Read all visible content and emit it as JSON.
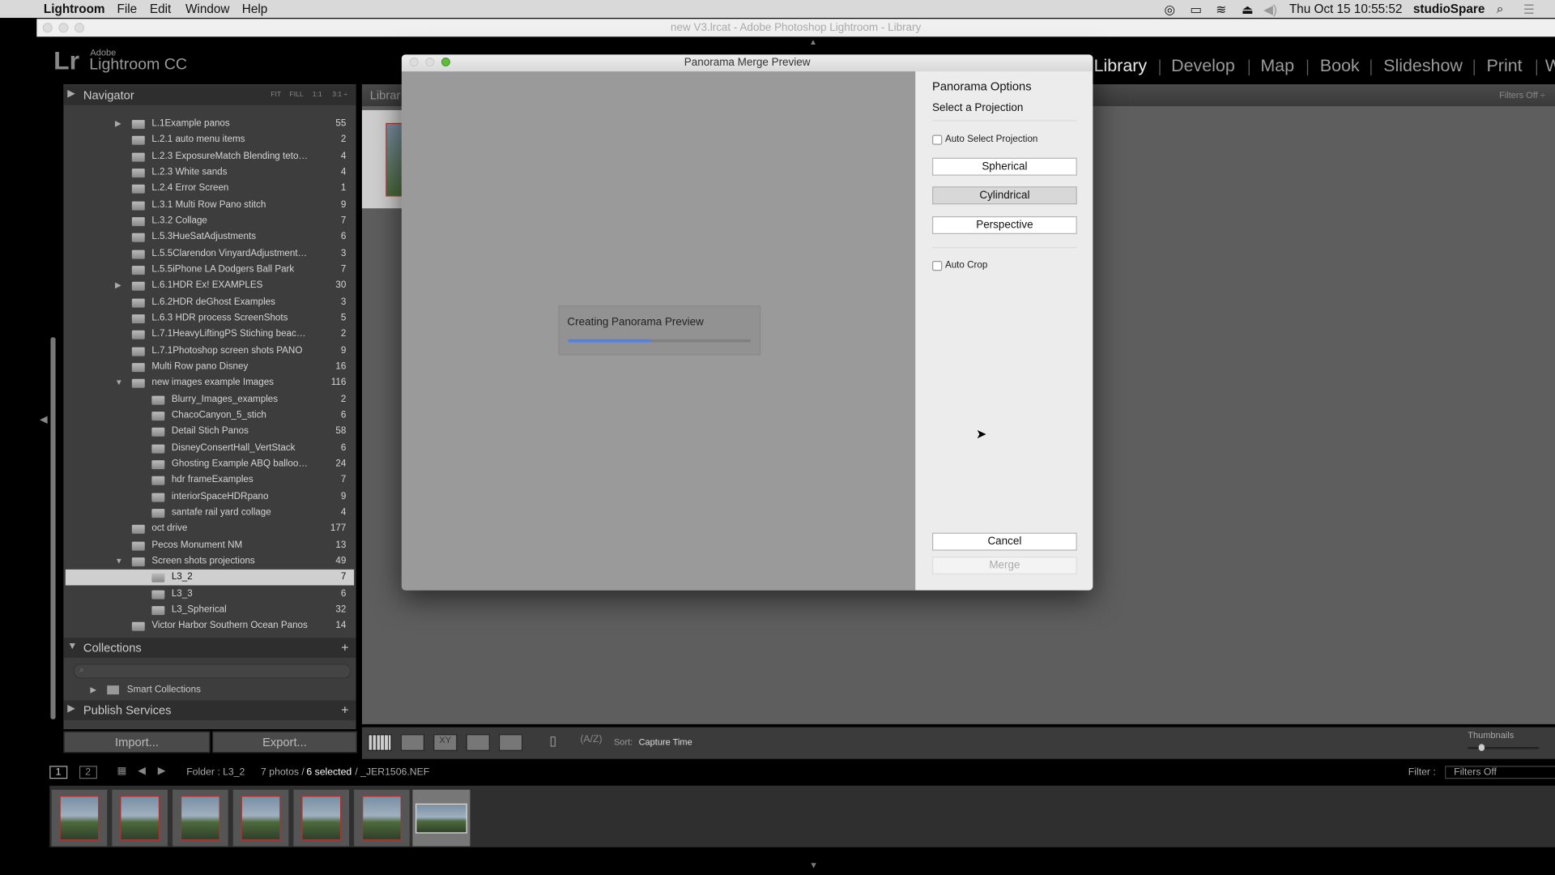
{
  "menubar": {
    "app": "Lightroom",
    "items": [
      "File",
      "Edit",
      "Window",
      "Help"
    ],
    "clock": "Thu Oct 15  10:55:52",
    "user": "studioSpare"
  },
  "window": {
    "title": "new V3.lrcat - Adobe Photoshop Lightroom - Library"
  },
  "logo": {
    "adobe": "Adobe",
    "product": "Lightroom CC",
    "mark": "Lr"
  },
  "modules": [
    "Library",
    "Develop",
    "Map",
    "Book",
    "Slideshow",
    "Print",
    "W"
  ],
  "navigator": {
    "title": "Navigator",
    "zoom": [
      "FIT",
      "FILL",
      "1:1",
      "3:1 ÷"
    ]
  },
  "library_tab": "Librar",
  "filters_off_top": "Filters Off ÷",
  "folders": [
    {
      "name": "L.1Example panos",
      "count": "55",
      "level": 0,
      "arrow": "right"
    },
    {
      "name": "L.2.1 auto menu items",
      "count": "2",
      "level": 0
    },
    {
      "name": "L.2.3 ExposureMatch Blending teto…",
      "count": "4",
      "level": 0
    },
    {
      "name": "L.2.3 White sands",
      "count": "4",
      "level": 0
    },
    {
      "name": "L.2.4 Error Screen",
      "count": "1",
      "level": 0
    },
    {
      "name": "L.3.1 Multi Row Pano stitch",
      "count": "9",
      "level": 0
    },
    {
      "name": "L.3.2 Collage",
      "count": "7",
      "level": 0
    },
    {
      "name": "L.5.3HueSatAdjustments",
      "count": "6",
      "level": 0
    },
    {
      "name": "L.5.5Clarendon VinyardAdjustment…",
      "count": "3",
      "level": 0
    },
    {
      "name": "L.5.5iPhone LA Dodgers Ball Park",
      "count": "7",
      "level": 0
    },
    {
      "name": "L.6.1HDR Ex! EXAMPLES",
      "count": "30",
      "level": 0,
      "arrow": "right"
    },
    {
      "name": "L.6.2HDR deGhost Examples",
      "count": "3",
      "level": 0
    },
    {
      "name": "L.6.3 HDR process ScreenShots",
      "count": "5",
      "level": 0
    },
    {
      "name": "L.7.1HeavyLiftingPS Stiching beac…",
      "count": "2",
      "level": 0
    },
    {
      "name": "L.7.1Photoshop screen shots PANO",
      "count": "9",
      "level": 0
    },
    {
      "name": "Multi Row pano Disney",
      "count": "16",
      "level": 0
    },
    {
      "name": "new images example Images",
      "count": "116",
      "level": 0,
      "arrow": "down"
    },
    {
      "name": "Blurry_Images_examples",
      "count": "2",
      "level": 1
    },
    {
      "name": "ChacoCanyon_5_stich",
      "count": "6",
      "level": 1
    },
    {
      "name": "Detail Stich Panos",
      "count": "58",
      "level": 1
    },
    {
      "name": "DisneyConsertHall_VertStack",
      "count": "6",
      "level": 1
    },
    {
      "name": "Ghosting Example ABQ balloo…",
      "count": "24",
      "level": 1
    },
    {
      "name": "hdr frameExamples",
      "count": "7",
      "level": 1
    },
    {
      "name": "interiorSpaceHDRpano",
      "count": "9",
      "level": 1
    },
    {
      "name": "santafe rail yard collage",
      "count": "4",
      "level": 1
    },
    {
      "name": "oct drive",
      "count": "177",
      "level": 0
    },
    {
      "name": "Pecos Monument NM",
      "count": "13",
      "level": 0
    },
    {
      "name": "Screen shots projections",
      "count": "49",
      "level": 0,
      "arrow": "down"
    },
    {
      "name": "L3_2",
      "count": "7",
      "level": 1,
      "selected": true
    },
    {
      "name": "L3_3",
      "count": "6",
      "level": 1
    },
    {
      "name": "L3_Spherical",
      "count": "32",
      "level": 1
    },
    {
      "name": "Victor Harbor Southern Ocean Panos",
      "count": "14",
      "level": 0
    }
  ],
  "collections": {
    "title": "Collections",
    "smart": "Smart Collections"
  },
  "publish": {
    "title": "Publish Services"
  },
  "buttons": {
    "import": "Import...",
    "export": "Export..."
  },
  "toolbar": {
    "sort_label": "Sort:",
    "sort_value": "Capture Time",
    "thumbnails": "Thumbnails",
    "thumbnail_level": 0.15
  },
  "filmbar": {
    "page1": "1",
    "page2": "2",
    "folder": "Folder : L3_2",
    "photos": "7 photos /",
    "selected": "6 selected",
    "file": "/ _JER1506.NEF",
    "filter_label": "Filter :",
    "filter_value": "Filters Off"
  },
  "dialog": {
    "title": "Panorama Merge Preview",
    "options_title": "Panorama Options",
    "projection_title": "Select a Projection",
    "auto_select": "Auto Select Projection",
    "projections": [
      "Spherical",
      "Cylindrical",
      "Perspective"
    ],
    "selected_projection": "Cylindrical",
    "auto_crop": "Auto Crop",
    "cancel": "Cancel",
    "merge": "Merge",
    "progress_text": "Creating Panorama Preview",
    "progress": 0.45,
    "progress_color": "#4f7ff0"
  }
}
